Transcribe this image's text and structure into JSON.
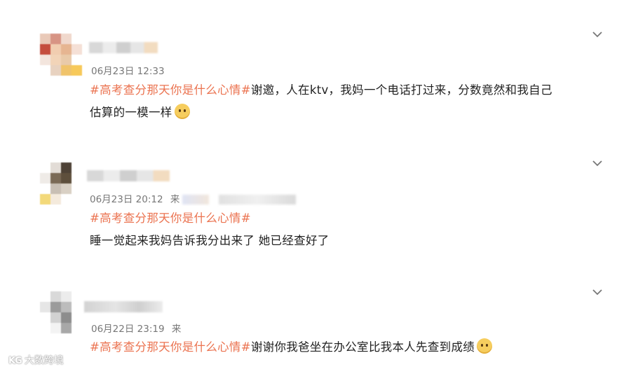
{
  "posts": [
    {
      "date": "06月23日 12:33",
      "hashtag": "#高考查分那天你是什么心情#",
      "body": "谢邀，人在ktv，我妈一个电话打过来，分数竟然和我自己",
      "body_line2": "估算的一模一样",
      "emoji": "doge-emoji"
    },
    {
      "date": "06月23日 20:12",
      "source_prefix": "来",
      "hashtag": "#高考查分那天你是什么心情#",
      "body": "睡一觉起来我妈告诉我分出来了 她已经查好了"
    },
    {
      "date": "06月22日 23:19",
      "source_prefix": "来",
      "hashtag": "#高考查分那天你是什么心情#",
      "body": "谢谢你我爸坐在办公室比我本人先查到成绩",
      "emoji": "awkward-emoji"
    }
  ],
  "watermark": {
    "logo": "KG",
    "text": "大数跨境"
  },
  "colors": {
    "hashtag": "#eb7350",
    "meta": "#777777",
    "text": "#222222"
  }
}
